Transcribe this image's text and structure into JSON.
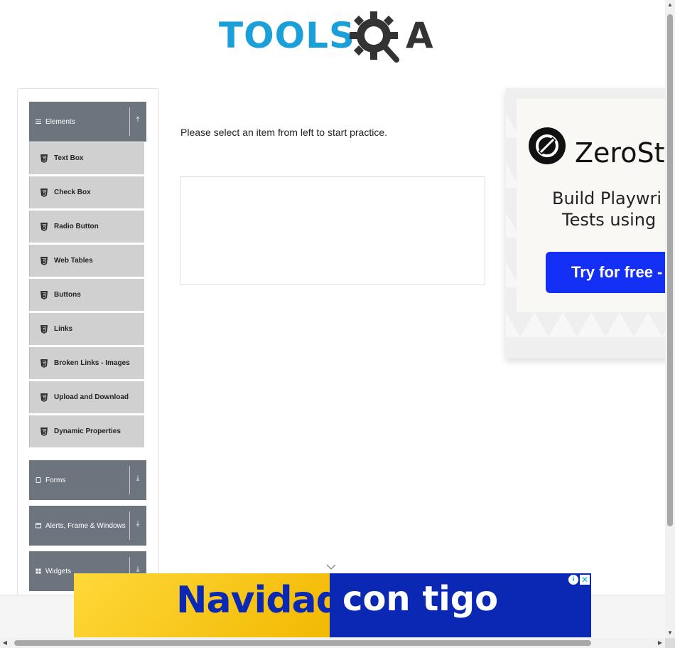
{
  "logo": {
    "tools_text": "TOOLS",
    "qa_text": "A"
  },
  "sidebar": {
    "groups": [
      {
        "label": "Elements",
        "icon": "hamburger-icon",
        "expanded": true
      },
      {
        "label": "Forms",
        "icon": "form-icon",
        "expanded": false
      },
      {
        "label": "Alerts, Frame & Windows",
        "icon": "window-icon",
        "expanded": false
      },
      {
        "label": "Widgets",
        "icon": "grid-icon",
        "expanded": false
      }
    ],
    "elements_items": [
      "Text Box",
      "Check Box",
      "Radio Button",
      "Web Tables",
      "Buttons",
      "Links",
      "Broken Links - Images",
      "Upload and Download",
      "Dynamic Properties"
    ],
    "arrow_up": "⤒",
    "arrow_down": "⤓"
  },
  "main": {
    "intro": "Please select an item from left to start practice."
  },
  "ad_right": {
    "brand": "ZeroSt",
    "line1": "Build Playwri",
    "line2": "Tests using",
    "button": "Try for free -"
  },
  "ad_bottom": {
    "left_text": "Navidad",
    "right_text": "con tigo",
    "info": "i",
    "close": "✕"
  },
  "colors": {
    "brand_blue": "#1a9fd9",
    "sidebar_header": "#6c757d",
    "sidebar_item": "#d0d0d0",
    "ad_button": "#1530f5",
    "ad_bottom_blue": "#0a28b4"
  }
}
